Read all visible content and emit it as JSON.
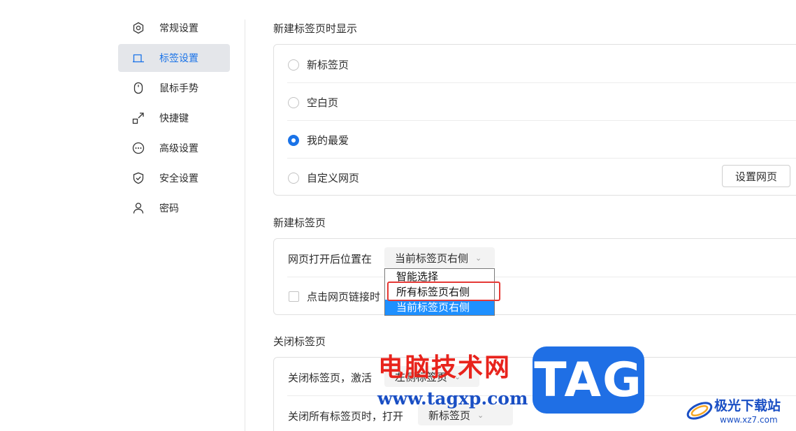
{
  "sidebar": {
    "items": [
      {
        "label": "常规设置",
        "icon": "hexagon-settings-icon"
      },
      {
        "label": "标签设置",
        "icon": "tab-icon",
        "active": true
      },
      {
        "label": "鼠标手势",
        "icon": "mouse-icon"
      },
      {
        "label": "快捷键",
        "icon": "shortcut-arrow-icon"
      },
      {
        "label": "高级设置",
        "icon": "more-dots-icon"
      },
      {
        "label": "安全设置",
        "icon": "shield-check-icon"
      },
      {
        "label": "密码",
        "icon": "user-icon"
      }
    ]
  },
  "new_tab_display": {
    "title": "新建标签页时显示",
    "options": [
      {
        "label": "新标签页",
        "checked": false
      },
      {
        "label": "空白页",
        "checked": false
      },
      {
        "label": "我的最爱",
        "checked": true
      },
      {
        "label": "自定义网页",
        "checked": false
      }
    ],
    "set_page_button": "设置网页"
  },
  "new_tab": {
    "title": "新建标签页",
    "position_label": "网页打开后位置在",
    "position_value": "当前标签页右侧",
    "checkbox_label": "点击网页链接时",
    "dropdown_options": [
      {
        "label": "智能选择",
        "selected": false
      },
      {
        "label": "所有标签页右侧",
        "selected": false
      },
      {
        "label": "当前标签页右侧",
        "selected": true
      }
    ]
  },
  "close_tab": {
    "title": "关闭标签页",
    "activate_label": "关闭标签页，激活",
    "activate_value": "左侧标签页",
    "close_all_label": "关闭所有标签页时，打开",
    "close_all_value": "新标签页"
  },
  "watermark": {
    "cn_text": "电脑技术网",
    "url": "www.tagxp.com",
    "tag": "TAG",
    "site_name": "极光下载站",
    "site_url": "www.xz7.com"
  },
  "colors": {
    "accent": "#1a73e8",
    "highlight": "#e53935",
    "dropdown_selected": "#1e90ff"
  }
}
